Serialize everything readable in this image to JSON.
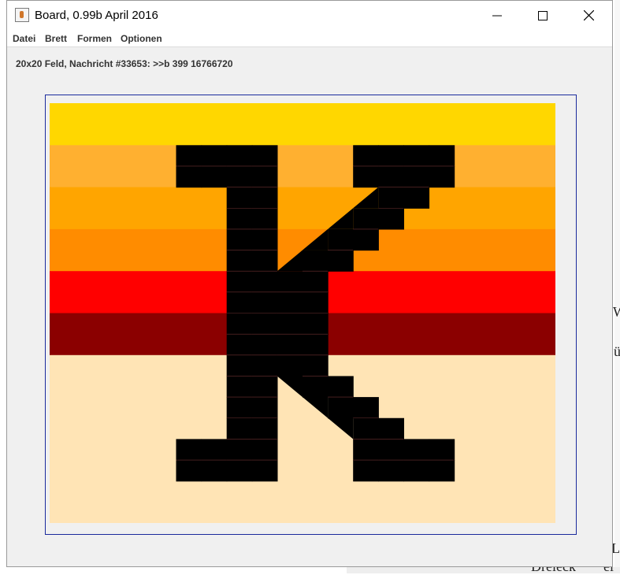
{
  "window": {
    "title": "Board, 0.99b April 2016",
    "controls": {
      "minimize": "minimize",
      "maximize": "maximize",
      "close": "close"
    }
  },
  "menu": {
    "items": [
      "Datei",
      "Brett",
      "Formen",
      "Optionen"
    ]
  },
  "status": {
    "text": "20x20 Feld, Nachricht #33653: >>b 399 16766720"
  },
  "board": {
    "grid": 20,
    "background_bands": [
      {
        "rows": [
          0,
          1
        ],
        "color": "#FFD700"
      },
      {
        "rows": [
          2,
          3
        ],
        "color": "#FFB030"
      },
      {
        "rows": [
          4,
          5
        ],
        "color": "#FFA500"
      },
      {
        "rows": [
          6,
          7
        ],
        "color": "#FF8C00"
      },
      {
        "rows": [
          8,
          9
        ],
        "color": "#FF0000"
      },
      {
        "rows": [
          10,
          11
        ],
        "color": "#8B0000"
      },
      {
        "rows": [
          12,
          19
        ],
        "color": "#FFE4B5"
      }
    ],
    "black_cells": [
      [
        2,
        5
      ],
      [
        2,
        6
      ],
      [
        2,
        7
      ],
      [
        2,
        8
      ],
      [
        2,
        12
      ],
      [
        2,
        13
      ],
      [
        2,
        14
      ],
      [
        2,
        15
      ],
      [
        3,
        5
      ],
      [
        3,
        6
      ],
      [
        3,
        7
      ],
      [
        3,
        8
      ],
      [
        3,
        12
      ],
      [
        3,
        13
      ],
      [
        3,
        14
      ],
      [
        3,
        15
      ],
      [
        4,
        7
      ],
      [
        4,
        8
      ],
      [
        4,
        13
      ],
      [
        4,
        14
      ],
      [
        5,
        7
      ],
      [
        5,
        8
      ],
      [
        5,
        12
      ],
      [
        5,
        13
      ],
      [
        6,
        7
      ],
      [
        6,
        8
      ],
      [
        6,
        11
      ],
      [
        6,
        12
      ],
      [
        7,
        7
      ],
      [
        7,
        8
      ],
      [
        7,
        10
      ],
      [
        7,
        11
      ],
      [
        8,
        7
      ],
      [
        8,
        8
      ],
      [
        8,
        9
      ],
      [
        8,
        10
      ],
      [
        9,
        7
      ],
      [
        9,
        8
      ],
      [
        9,
        9
      ],
      [
        9,
        10
      ],
      [
        10,
        7
      ],
      [
        10,
        8
      ],
      [
        10,
        9
      ],
      [
        10,
        10
      ],
      [
        11,
        7
      ],
      [
        11,
        8
      ],
      [
        11,
        9
      ],
      [
        11,
        10
      ],
      [
        12,
        7
      ],
      [
        12,
        8
      ],
      [
        12,
        9
      ],
      [
        12,
        10
      ],
      [
        13,
        7
      ],
      [
        13,
        8
      ],
      [
        13,
        10
      ],
      [
        13,
        11
      ],
      [
        14,
        7
      ],
      [
        14,
        8
      ],
      [
        14,
        11
      ],
      [
        14,
        12
      ],
      [
        15,
        7
      ],
      [
        15,
        8
      ],
      [
        15,
        12
      ],
      [
        15,
        13
      ],
      [
        16,
        5
      ],
      [
        16,
        6
      ],
      [
        16,
        7
      ],
      [
        16,
        8
      ],
      [
        16,
        12
      ],
      [
        16,
        13
      ],
      [
        16,
        14
      ],
      [
        16,
        15
      ],
      [
        17,
        5
      ],
      [
        17,
        6
      ],
      [
        17,
        7
      ],
      [
        17,
        8
      ],
      [
        17,
        12
      ],
      [
        17,
        13
      ],
      [
        17,
        14
      ],
      [
        17,
        15
      ]
    ],
    "triangles": [
      {
        "cell": [
          4,
          12
        ],
        "corner": "br"
      },
      {
        "cell": [
          5,
          11
        ],
        "corner": "br"
      },
      {
        "cell": [
          6,
          10
        ],
        "corner": "br"
      },
      {
        "cell": [
          7,
          9
        ],
        "corner": "br"
      },
      {
        "cell": [
          13,
          9
        ],
        "corner": "tr"
      },
      {
        "cell": [
          14,
          10
        ],
        "corner": "tr"
      },
      {
        "cell": [
          15,
          11
        ],
        "corner": "tr"
      }
    ]
  },
  "background_fragments": [
    "W",
    "ü",
    "Dreieck",
    "Le",
    "ei"
  ]
}
